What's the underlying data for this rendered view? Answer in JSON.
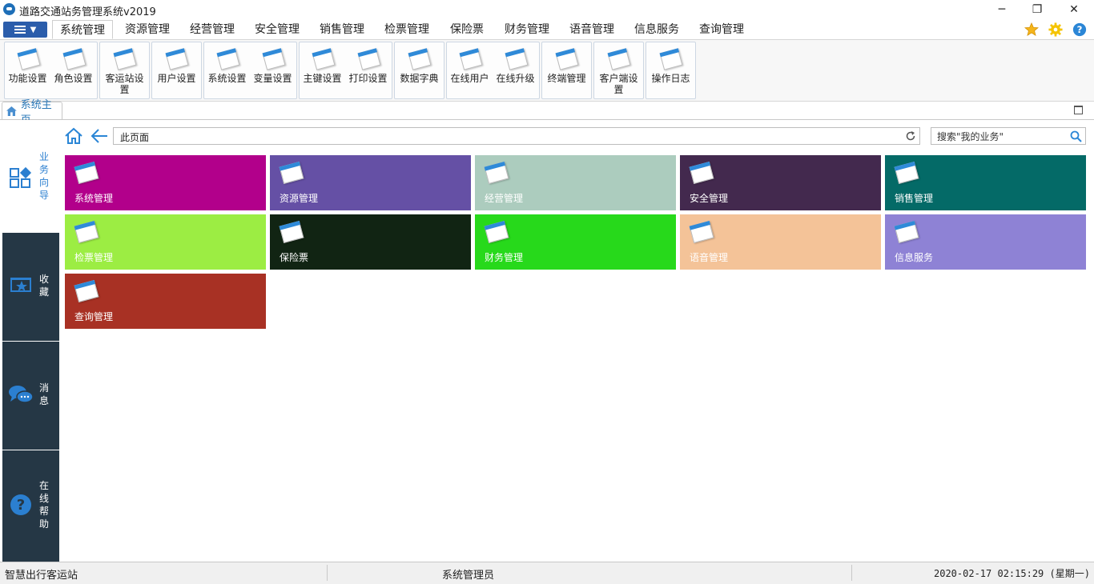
{
  "window": {
    "title": "道路交通站务管理系统v2019",
    "minimize": "─",
    "restore": "❐",
    "close": "✕"
  },
  "menu": {
    "tabs": [
      "系统管理",
      "资源管理",
      "经营管理",
      "安全管理",
      "销售管理",
      "检票管理",
      "保险票",
      "财务管理",
      "语音管理",
      "信息服务",
      "查询管理"
    ],
    "active_tab": "系统管理",
    "right_icons": [
      "star-icon",
      "gear-icon",
      "help-icon"
    ]
  },
  "ribbon": {
    "buttons": [
      "功能设置",
      "角色设置",
      "客运站设置",
      "用户设置",
      "系统设置",
      "变量设置",
      "主键设置",
      "打印设置",
      "数据字典",
      "在线用户",
      "在线升级",
      "终端管理",
      "客户端设置",
      "操作日志"
    ]
  },
  "doc_tab": {
    "label": "系统主页"
  },
  "sidebar": [
    {
      "label": "业务向导",
      "icon": "grid-icon"
    },
    {
      "label": "收藏",
      "icon": "favorite-icon"
    },
    {
      "label": "消息",
      "icon": "chat-icon"
    },
    {
      "label": "在线帮助",
      "icon": "help-icon"
    }
  ],
  "address": {
    "text": "此页面"
  },
  "search": {
    "placeholder": "搜索\"我的业务\""
  },
  "tiles": [
    {
      "label": "系统管理",
      "color": "#b2008b"
    },
    {
      "label": "资源管理",
      "color": "#6550a5"
    },
    {
      "label": "经营管理",
      "color": "#acccbe"
    },
    {
      "label": "安全管理",
      "color": "#43294e"
    },
    {
      "label": "销售管理",
      "color": "#046a67"
    },
    {
      "label": "检票管理",
      "color": "#9ced43"
    },
    {
      "label": "保险票",
      "color": "#112413"
    },
    {
      "label": "财务管理",
      "color": "#27d91b"
    },
    {
      "label": "语音管理",
      "color": "#f4c398"
    },
    {
      "label": "信息服务",
      "color": "#8e82d5"
    },
    {
      "label": "查询管理",
      "color": "#a83124"
    }
  ],
  "status": {
    "station": "智慧出行客运站",
    "user": "系统管理员",
    "datetime": "2020-02-17 02:15:29 (星期一)"
  },
  "colors": {
    "sidebar_dark": "#253745",
    "accent_blue": "#2b7fd0"
  }
}
